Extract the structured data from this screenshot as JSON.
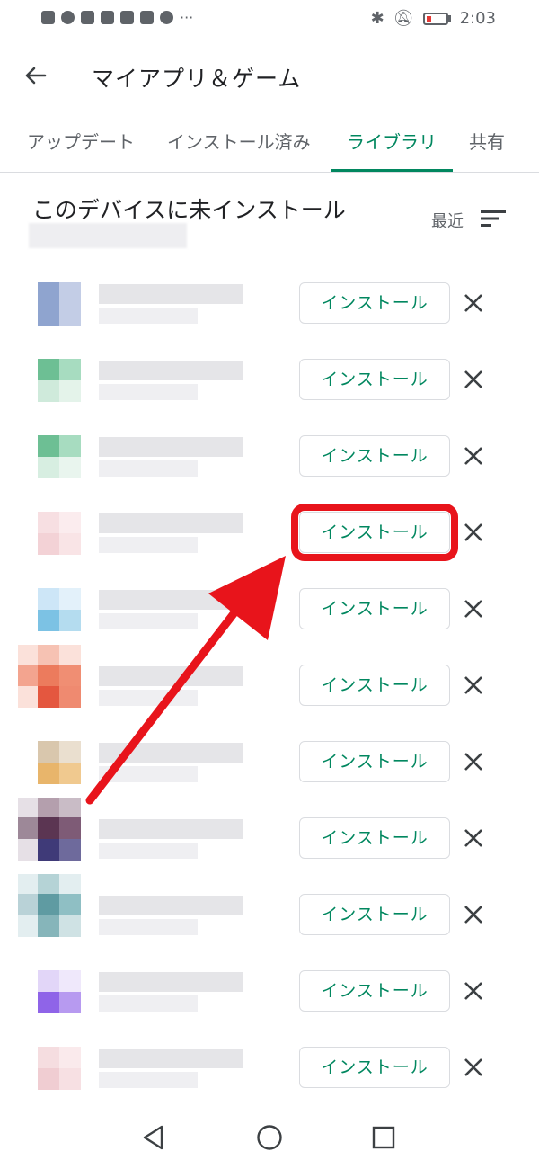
{
  "status_bar": {
    "time": "2:03",
    "dots": "···"
  },
  "app_bar": {
    "title": "マイアプリ＆ゲーム",
    "back_icon": "arrow-back-icon"
  },
  "tabs": [
    {
      "label": "アップデート",
      "active": false
    },
    {
      "label": "インストール済み",
      "active": false
    },
    {
      "label": "ライブラリ",
      "active": true
    },
    {
      "label": "共有",
      "active": false
    }
  ],
  "section": {
    "title": "このデバイスに未インストール",
    "sort_label": "最近",
    "sort_icon": "sort-icon"
  },
  "apps": [
    {
      "install_label": "インストール",
      "highlighted": false
    },
    {
      "install_label": "インストール",
      "highlighted": false
    },
    {
      "install_label": "インストール",
      "highlighted": false
    },
    {
      "install_label": "インストール",
      "highlighted": true
    },
    {
      "install_label": "インストール",
      "highlighted": false
    },
    {
      "install_label": "インストール",
      "highlighted": false
    },
    {
      "install_label": "インストール",
      "highlighted": false
    },
    {
      "install_label": "インストール",
      "highlighted": false
    },
    {
      "install_label": "インストール",
      "highlighted": false
    },
    {
      "install_label": "インストール",
      "highlighted": false
    },
    {
      "install_label": "インストール",
      "highlighted": false
    }
  ],
  "colors": {
    "accent": "#01875f",
    "highlight": "#e8141b",
    "annotation_arrow": "#e8141b"
  },
  "nav_bar": [
    "back-triangle-icon",
    "home-circle-icon",
    "recents-square-icon"
  ]
}
